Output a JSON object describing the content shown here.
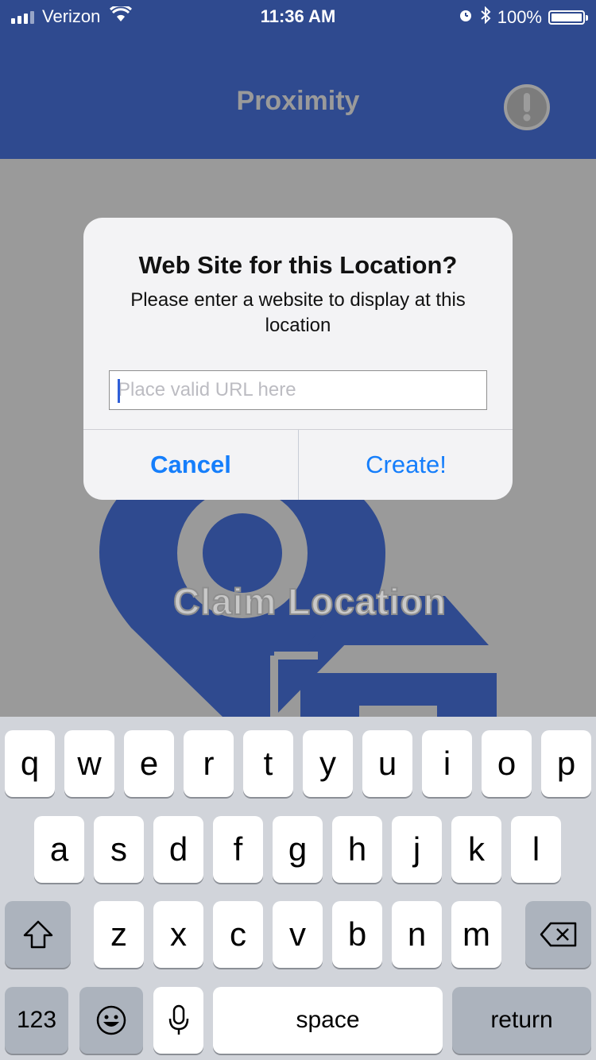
{
  "status_bar": {
    "carrier": "Verizon",
    "time": "11:36 AM",
    "battery": "100%",
    "icons": [
      "signal-icon",
      "wifi-icon",
      "alarm-icon",
      "bluetooth-icon",
      "battery-icon"
    ]
  },
  "nav": {
    "title": "Proximity",
    "alert_icon": "exclamation-icon"
  },
  "background": {
    "claim_label": "Claim Location"
  },
  "dialog": {
    "title": "Web Site for this Location?",
    "message": "Please enter a website to display at this location",
    "input_value": "",
    "input_placeholder": "Place valid URL here",
    "cancel_label": "Cancel",
    "create_label": "Create!"
  },
  "keyboard": {
    "row1": [
      "q",
      "w",
      "e",
      "r",
      "t",
      "y",
      "u",
      "i",
      "o",
      "p"
    ],
    "row2": [
      "a",
      "s",
      "d",
      "f",
      "g",
      "h",
      "j",
      "k",
      "l"
    ],
    "row3": [
      "z",
      "x",
      "c",
      "v",
      "b",
      "n",
      "m"
    ],
    "numbers_label": "123",
    "space_label": "space",
    "return_label": "return",
    "icons": [
      "shift-icon",
      "backspace-icon",
      "emoji-icon",
      "microphone-icon"
    ]
  },
  "colors": {
    "nav_blue": "#2f4a8f",
    "link_blue": "#157efb",
    "dim_gray": "#9a9a9a"
  }
}
